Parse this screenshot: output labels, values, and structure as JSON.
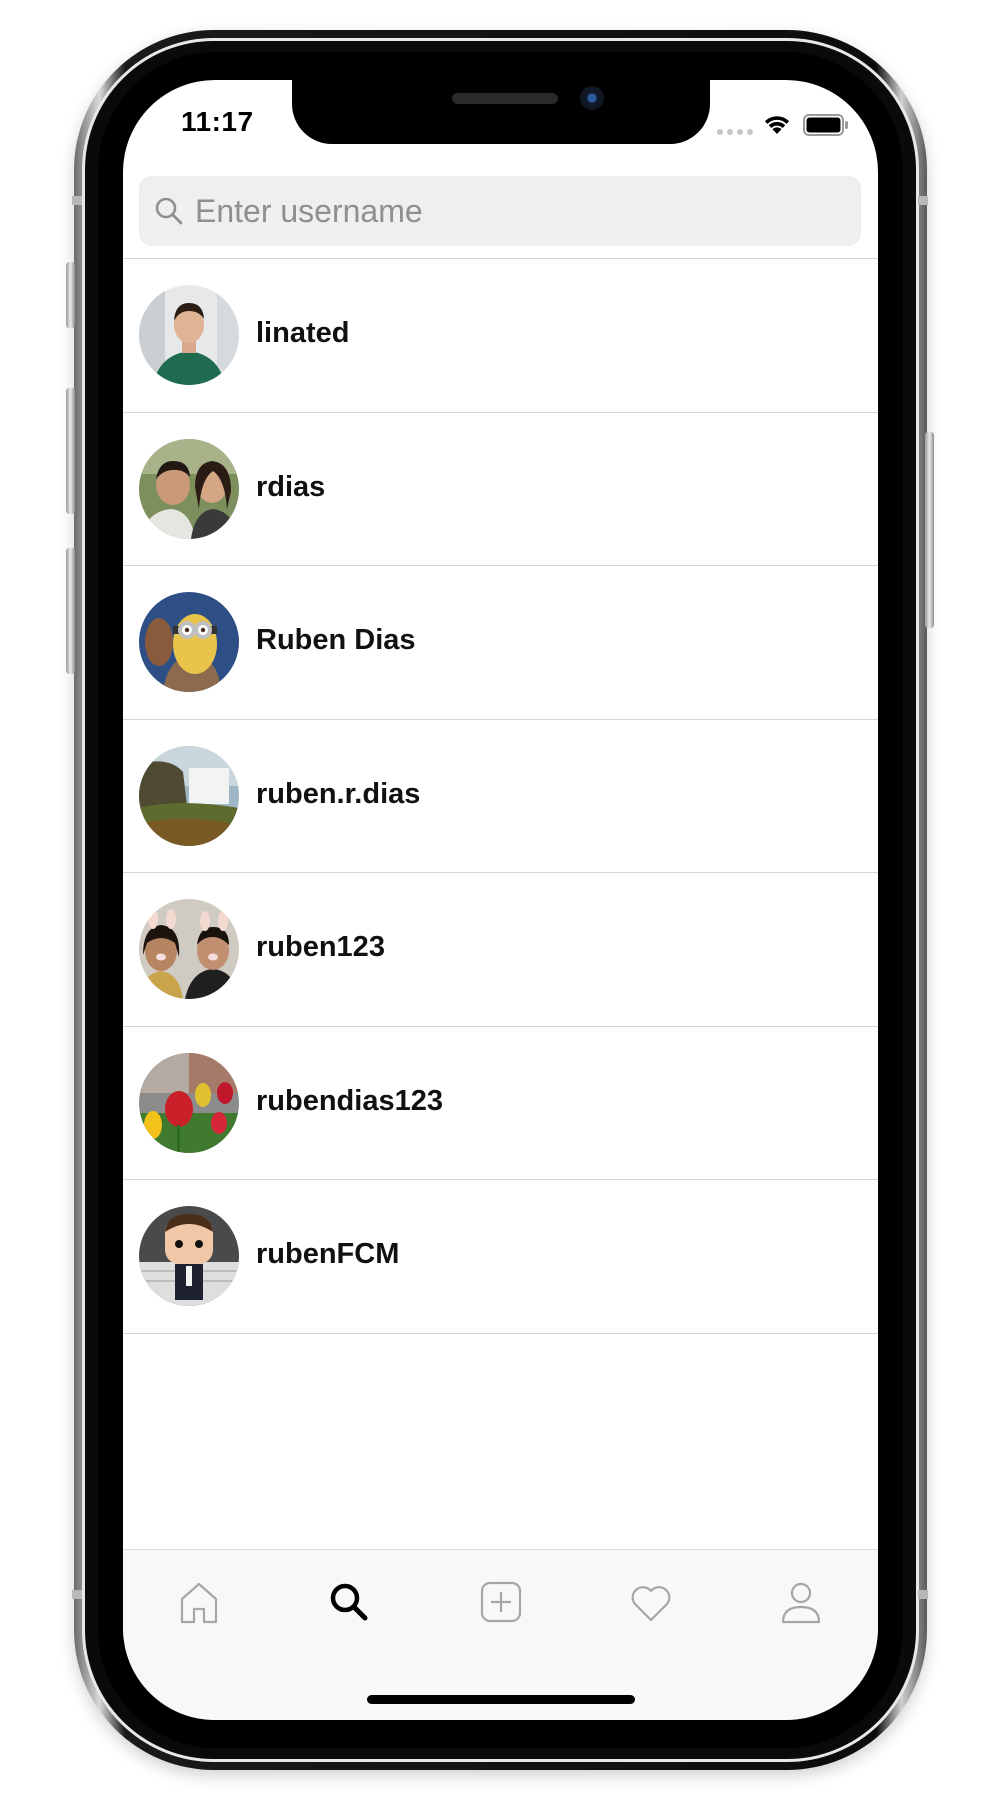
{
  "status_bar": {
    "time": "11:17"
  },
  "search": {
    "placeholder": "Enter username"
  },
  "users": [
    {
      "username": "linated"
    },
    {
      "username": "rdias"
    },
    {
      "username": "Ruben Dias"
    },
    {
      "username": "ruben.r.dias"
    },
    {
      "username": "ruben123"
    },
    {
      "username": "rubendias123"
    },
    {
      "username": "rubenFCM"
    }
  ],
  "tab_bar": {
    "tabs": [
      {
        "icon": "home-icon",
        "active": false
      },
      {
        "icon": "search-icon",
        "active": true
      },
      {
        "icon": "add-post-icon",
        "active": false
      },
      {
        "icon": "heart-icon",
        "active": false
      },
      {
        "icon": "profile-icon",
        "active": false
      }
    ]
  },
  "colors": {
    "active_tab": "#000000",
    "inactive_tab": "#a6a6a6",
    "search_background": "#efefef",
    "divider": "#d6d6d6"
  }
}
